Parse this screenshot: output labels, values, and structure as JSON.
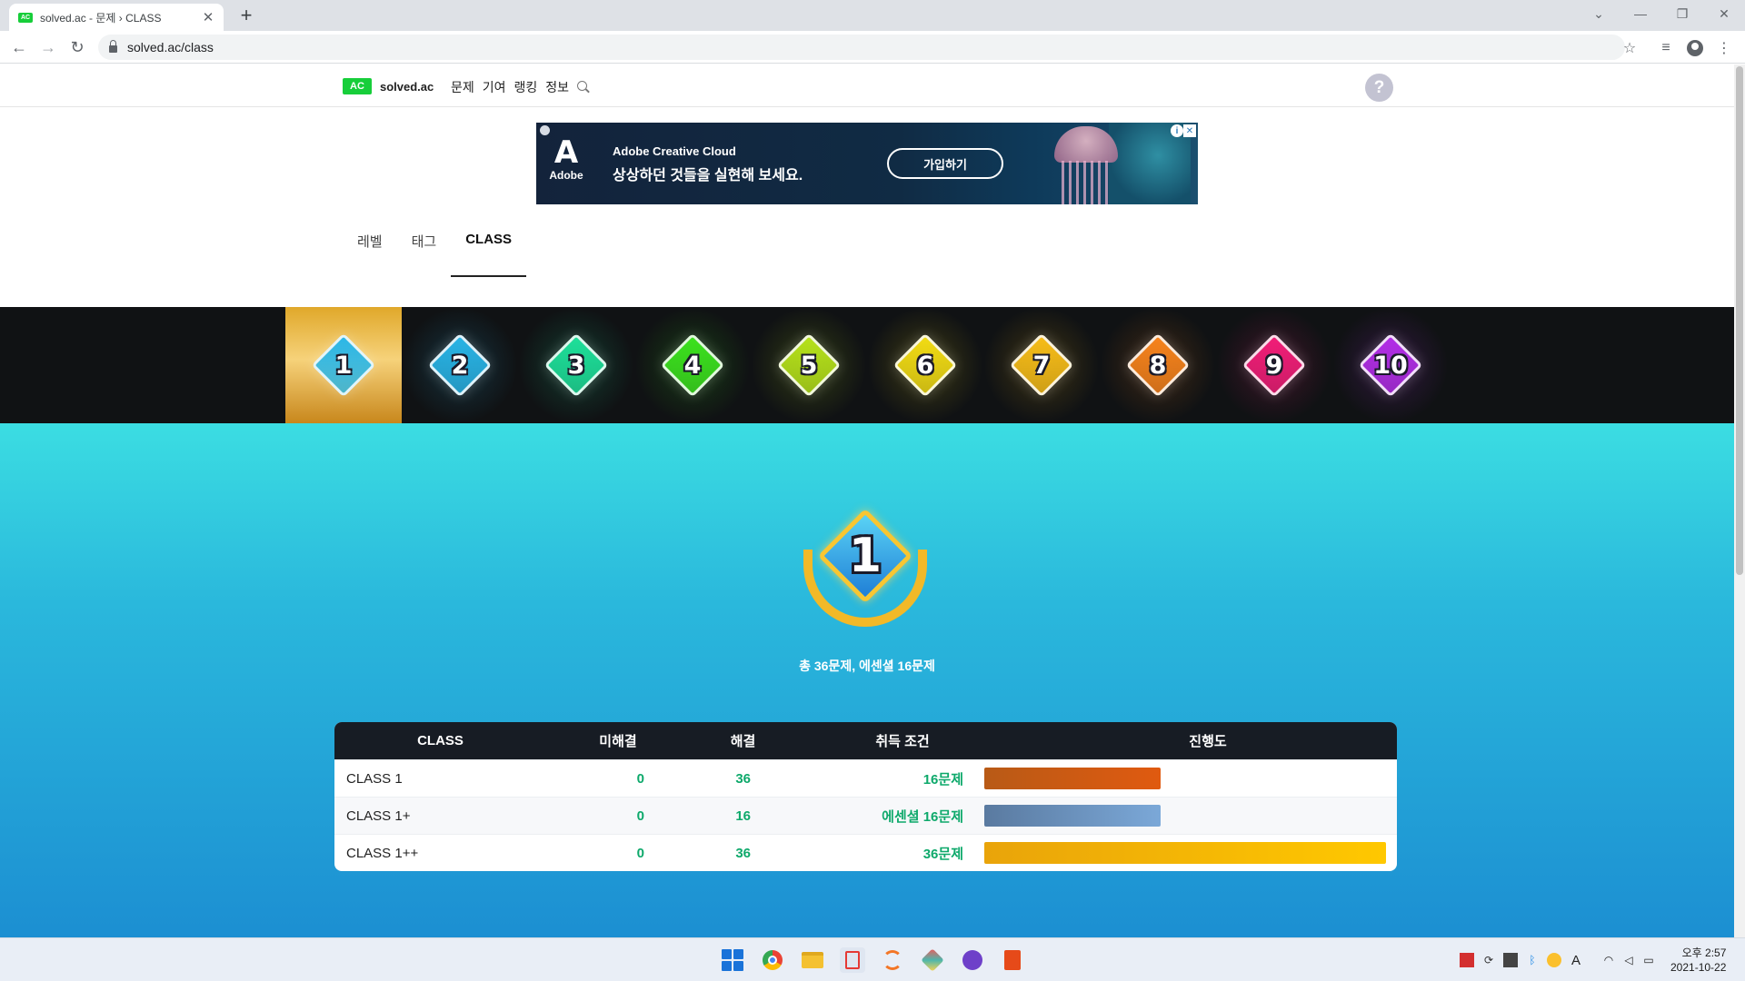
{
  "browser": {
    "tab_title": "solved.ac - 문제 › CLASS",
    "favicon_text": "AC",
    "url": "solved.ac/class"
  },
  "site": {
    "brand_badge": "AC",
    "brand_name": "solved.ac",
    "nav": [
      "문제",
      "기여",
      "랭킹",
      "정보"
    ],
    "help_label": "?"
  },
  "ad": {
    "logo_mark": "A",
    "logo_text": "Adobe",
    "brand": "Adobe Creative Cloud",
    "tagline": "상상하던 것들을 실현해 보세요.",
    "cta": "가입하기",
    "info": "i",
    "close": "✕"
  },
  "subtabs": [
    "레벨",
    "태그",
    "CLASS"
  ],
  "class_tiers": [
    {
      "num": "1",
      "color": "#2bb7e8"
    },
    {
      "num": "2",
      "color": "#29b4e6"
    },
    {
      "num": "3",
      "color": "#1ee09a"
    },
    {
      "num": "4",
      "color": "#3ce21e"
    },
    {
      "num": "5",
      "color": "#b6e21b"
    },
    {
      "num": "6",
      "color": "#f2dc14"
    },
    {
      "num": "7",
      "color": "#f7bd18"
    },
    {
      "num": "8",
      "color": "#f7831c"
    },
    {
      "num": "9",
      "color": "#f21e78"
    },
    {
      "num": "10",
      "color": "#b32ee8"
    }
  ],
  "hero": {
    "class_num": "1",
    "summary": "총 36문제, 에센셜 16문제"
  },
  "table": {
    "headers": {
      "class": "CLASS",
      "unsolved": "미해결",
      "solved": "해결",
      "condition": "취득 조건",
      "progress": "진행도"
    },
    "rows": [
      {
        "name": "CLASS 1",
        "unsolved": "0",
        "solved": "36",
        "condition": "16문제",
        "progress": 0.44,
        "bar_color_a": "#b85a16",
        "bar_color_b": "#e05a10"
      },
      {
        "name": "CLASS 1+",
        "unsolved": "0",
        "solved": "16",
        "condition": "에센셜 16문제",
        "progress": 0.44,
        "bar_color_a": "#5a7aa0",
        "bar_color_b": "#7ba8d8"
      },
      {
        "name": "CLASS 1++",
        "unsolved": "0",
        "solved": "36",
        "condition": "36문제",
        "progress": 1.0,
        "bar_color_a": "#e9a40a",
        "bar_color_b": "#ffc800"
      }
    ]
  },
  "taskbar": {
    "clock_time": "오후 2:57",
    "clock_date": "2021-10-22",
    "lang": "A"
  }
}
